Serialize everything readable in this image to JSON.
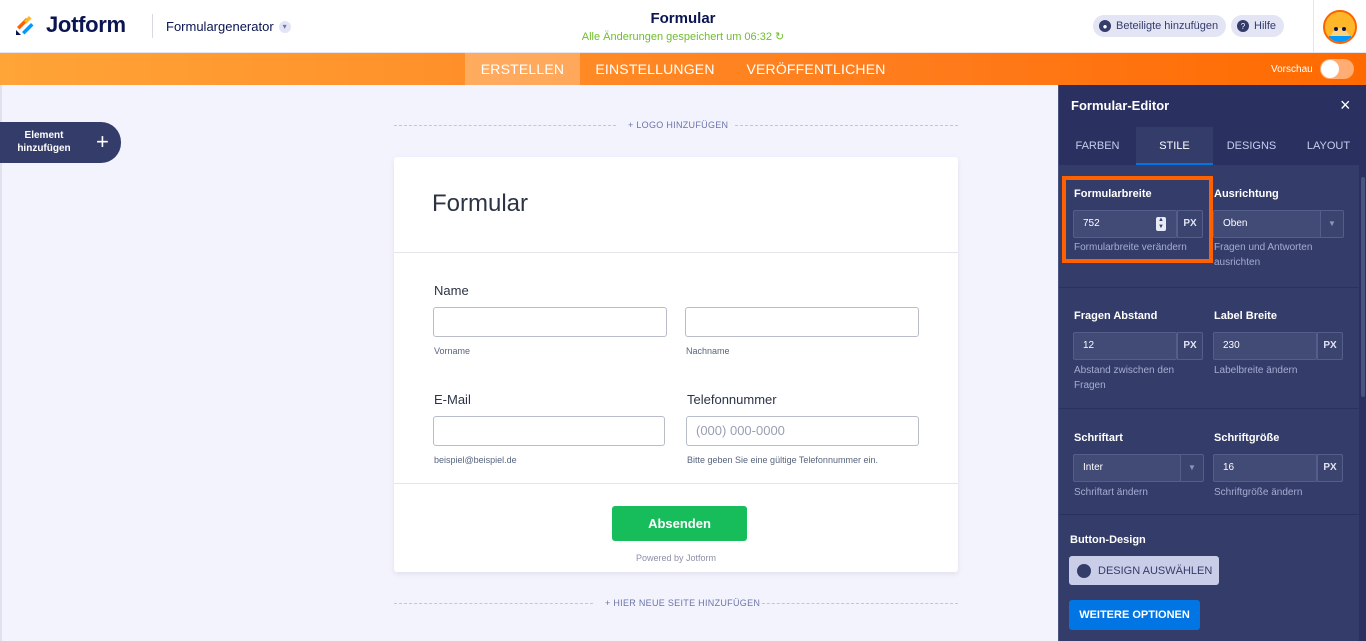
{
  "header": {
    "brand": "Jotform",
    "app_name": "Formulargenerator",
    "doc_title": "Formular",
    "save_status": "Alle Änderungen gespeichert um 06:32",
    "invite_label": "Beteiligte hinzufügen",
    "help_label": "Hilfe"
  },
  "nav": {
    "tabs": [
      "ERSTELLEN",
      "EINSTELLUNGEN",
      "VERÖFFENTLICHEN"
    ],
    "active": "ERSTELLEN",
    "preview_label": "Vorschau",
    "preview_on": false
  },
  "sidebar": {
    "add_element_label": "Element hinzufügen",
    "add_icon": "+"
  },
  "canvas": {
    "add_logo": "+ LOGO HINZUFÜGEN",
    "add_page": "+ HIER NEUE SEITE HINZUFÜGEN"
  },
  "form": {
    "title": "Formular",
    "name_label": "Name",
    "first_sublabel": "Vorname",
    "last_sublabel": "Nachname",
    "email_label": "E-Mail",
    "email_sublabel": "beispiel@beispiel.de",
    "phone_label": "Telefonnummer",
    "phone_placeholder": "(000) 000-0000",
    "phone_sublabel": "Bitte geben Sie eine gültige Telefonnummer ein.",
    "submit_label": "Absenden",
    "powered_by": "Powered by Jotform"
  },
  "panel": {
    "title": "Formular-Editor",
    "close_icon": "×",
    "tabs": [
      "FARBEN",
      "STILE",
      "DESIGNS",
      "LAYOUT"
    ],
    "active_tab": "STILE",
    "form_width": {
      "label": "Formularbreite",
      "value": "752",
      "unit": "PX",
      "help": "Formularbreite verändern"
    },
    "alignment": {
      "label": "Ausrichtung",
      "value": "Oben",
      "help": "Fragen und Antworten ausrichten"
    },
    "question_spacing": {
      "label": "Fragen Abstand",
      "value": "12",
      "unit": "PX",
      "help": "Abstand zwischen den Fragen"
    },
    "label_width": {
      "label": "Label Breite",
      "value": "230",
      "unit": "PX",
      "help": "Labelbreite ändern"
    },
    "font": {
      "label": "Schriftart",
      "value": "Inter",
      "help": "Schriftart ändern"
    },
    "font_size": {
      "label": "Schriftgröße",
      "value": "16",
      "unit": "PX",
      "help": "Schriftgröße ändern"
    },
    "button_design_label": "Button-Design",
    "design_select_label": "DESIGN AUSWÄHLEN",
    "more_options_label": "WEITERE OPTIONEN"
  },
  "colors": {
    "orange": "#ff6100",
    "navy": "#0a1551",
    "panel": "#343c6a",
    "submit": "#18bd5b",
    "blue": "#0075e3"
  }
}
